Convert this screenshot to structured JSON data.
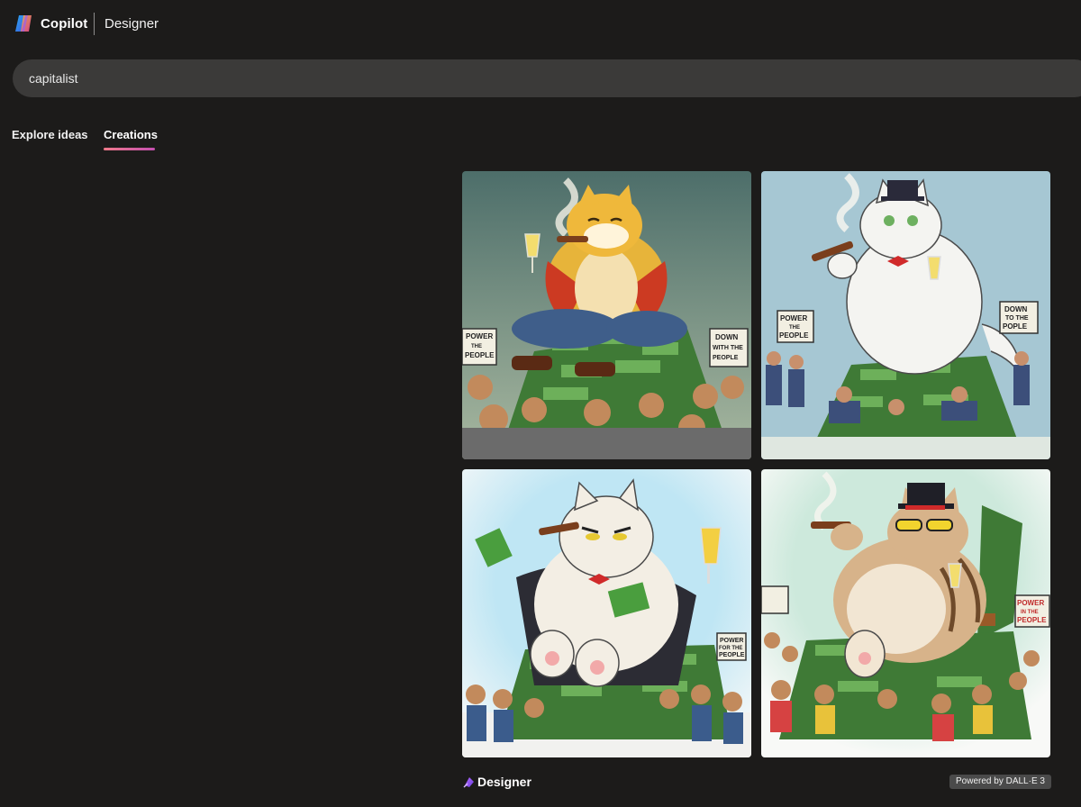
{
  "header": {
    "brand": "Copilot",
    "product": "Designer"
  },
  "search": {
    "value": "capitalist"
  },
  "tabs": [
    {
      "label": "Explore ideas",
      "active": false
    },
    {
      "label": "Creations",
      "active": true
    }
  ],
  "images": [
    {
      "subject": "fat orange cat capitalist with cigar and champagne on money pile",
      "signs": [
        "POWER",
        "THE",
        "PEOPLE",
        "DOWN",
        "WITH THE",
        "PEOPLE"
      ]
    },
    {
      "subject": "white cat with top hat and cigar on money pile",
      "signs": [
        "POWER",
        "THE",
        "PEOPLE",
        "DOWN",
        "TO THE",
        "POPLE"
      ]
    },
    {
      "subject": "grumpy white cat in tuxedo holding cash and champagne",
      "signs": [
        "POWER",
        "FOR THE",
        "PEOPLE"
      ]
    },
    {
      "subject": "tabby cat with top hat and sunglasses on throne of money",
      "signs": [
        "POWER",
        "IN THE",
        "PEOPLE"
      ]
    }
  ],
  "footer": {
    "brand": "Designer",
    "badge": "Powered by DALL·E 3"
  },
  "colors": {
    "background": "#1c1b1a",
    "search_bg": "#3b3a39",
    "tab_underline": "#d8609c"
  }
}
